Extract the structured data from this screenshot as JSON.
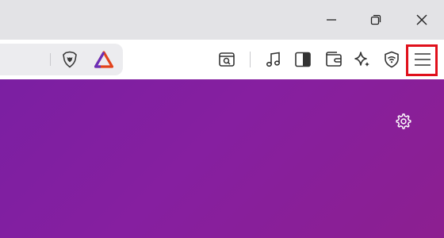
{
  "window_controls": {
    "minimize_icon": "minimize-icon",
    "restore_icon": "restore-icon",
    "close_icon": "close-icon"
  },
  "address_bar": {
    "shield_icon": "brave-shields-lion-icon",
    "rewards_icon": "brave-rewards-triangle-icon"
  },
  "toolbar": {
    "items": [
      {
        "name": "search-tab-icon"
      },
      {
        "name": "media-music-icon"
      },
      {
        "name": "sidebar-toggle-icon"
      },
      {
        "name": "wallet-icon"
      },
      {
        "name": "leo-ai-sparkle-icon"
      },
      {
        "name": "vpn-shield-wifi-icon"
      },
      {
        "name": "hamburger-menu-icon"
      }
    ]
  },
  "colors": {
    "titlebar": "#e3e3e6",
    "content_gradient_start": "#7b1fa2",
    "content_gradient_end": "#8c1f90",
    "highlight": "#e0101b",
    "brave_orange": "#ff5000"
  },
  "content": {
    "settings_icon": "gear-icon"
  }
}
